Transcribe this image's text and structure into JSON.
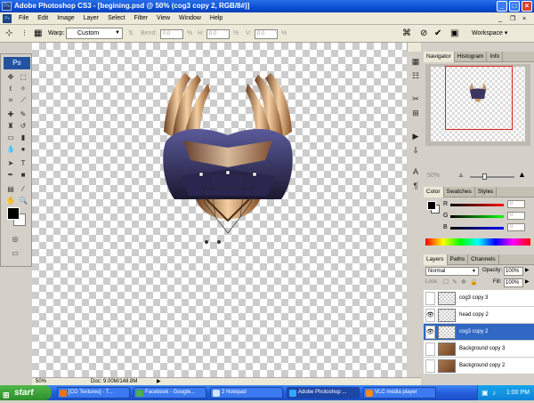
{
  "window": {
    "title": "Adobe Photoshop CS3 - [begining.psd @ 50% (cog3 copy 2, RGB/8#)]"
  },
  "menu": [
    "File",
    "Edit",
    "Image",
    "Layer",
    "Select",
    "Filter",
    "View",
    "Window",
    "Help"
  ],
  "options": {
    "warp_label": "Warp:",
    "warp_value": "Custom",
    "bend_label": "Bend:",
    "bend_value": "0.0",
    "h_label": "H:",
    "h_value": "0.0",
    "v_label": "V:",
    "v_value": "0.0",
    "workspace": "Workspace ▾"
  },
  "toolbox": {
    "logo": "Ps"
  },
  "status": {
    "zoom": "50%",
    "doc": "Doc: 9.00M/148.8M"
  },
  "navigator": {
    "tabs": [
      "Navigator",
      "Histogram",
      "Info"
    ],
    "zoom": "50%"
  },
  "color_panel": {
    "tabs": [
      "Color",
      "Swatches",
      "Styles"
    ],
    "channels": [
      {
        "label": "R",
        "value": "0"
      },
      {
        "label": "G",
        "value": "0"
      },
      {
        "label": "B",
        "value": "0"
      }
    ]
  },
  "layers_panel": {
    "tabs": [
      "Layers",
      "Paths",
      "Channels"
    ],
    "blend_mode": "Normal",
    "opacity_label": "Opacity:",
    "opacity": "100%",
    "lock_label": "Lock:",
    "fill_label": "Fill:",
    "fill": "100%",
    "layers": [
      {
        "name": "cog3 copy 3",
        "visible": false,
        "selected": false,
        "thumb": "empty"
      },
      {
        "name": "head copy 2",
        "visible": true,
        "selected": false,
        "thumb": "empty"
      },
      {
        "name": "cog3 copy 2",
        "visible": true,
        "selected": true,
        "thumb": "empty"
      },
      {
        "name": "Background copy 3",
        "visible": false,
        "selected": false,
        "thumb": "texture"
      },
      {
        "name": "Background copy 2",
        "visible": false,
        "selected": false,
        "thumb": "texture"
      }
    ]
  },
  "taskbar": {
    "start": "start",
    "tasks": [
      {
        "label": "[CG Textures] - T...",
        "active": false,
        "color": "#e8731c"
      },
      {
        "label": "Facebook - Google...",
        "active": false,
        "color": "#4cae4c"
      },
      {
        "label": "2 Notepad",
        "active": false,
        "color": "#cfe6ff"
      },
      {
        "label": "Adobe Photoshop ...",
        "active": true,
        "color": "#31a8ff"
      },
      {
        "label": "VLC media player",
        "active": false,
        "color": "#f08a1c"
      }
    ],
    "clock": "1:00 PM"
  }
}
